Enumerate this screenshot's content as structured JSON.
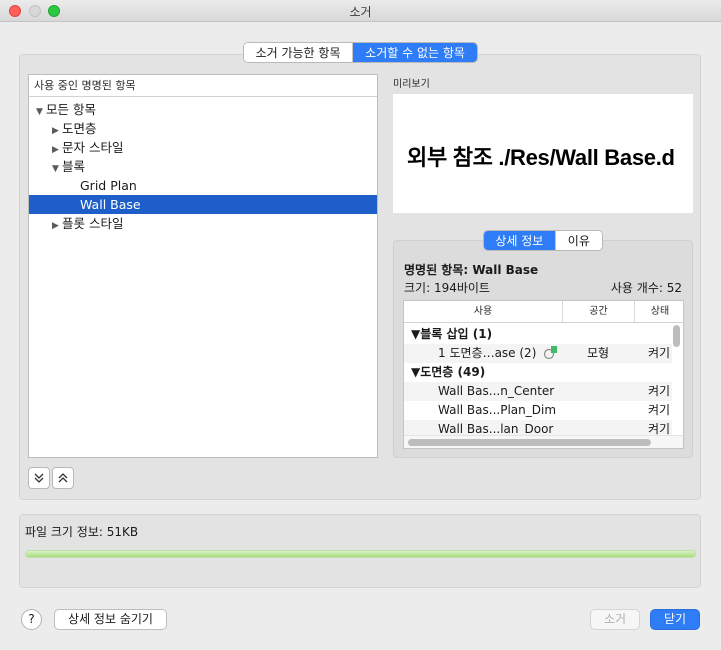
{
  "window": {
    "title": "소거"
  },
  "top_tabs": [
    {
      "label": "소거 가능한 항목",
      "active": false
    },
    {
      "label": "소거할 수 없는 항목",
      "active": true
    }
  ],
  "tree": {
    "header": "사용 중인 명명된 항목",
    "items": [
      {
        "label": "모든 항목",
        "expanded": true,
        "level": 0
      },
      {
        "label": "도면층",
        "expanded": false,
        "level": 1
      },
      {
        "label": "문자 스타일",
        "expanded": false,
        "level": 1
      },
      {
        "label": "블록",
        "expanded": true,
        "level": 1
      },
      {
        "label": "Grid Plan",
        "level": 2
      },
      {
        "label": "Wall Base",
        "level": 2,
        "selected": true
      },
      {
        "label": "플롯 스타일",
        "expanded": false,
        "level": 1
      }
    ]
  },
  "preview": {
    "label": "미리보기",
    "text": "외부 참조 ./Res/Wall Base.d"
  },
  "detail_tabs": [
    {
      "label": "상세 정보",
      "active": true
    },
    {
      "label": "이유",
      "active": false
    }
  ],
  "details": {
    "name_line": "명명된 항목: Wall Base",
    "size_line": "크기: 194바이트",
    "count_line": "사용 개수: 52",
    "columns": [
      "사용",
      "공간",
      "상태"
    ],
    "rows": [
      {
        "type": "group",
        "label": "▼블록 삽입 (1)"
      },
      {
        "type": "item",
        "use": "1 도면층…ase (2)",
        "space": "모형",
        "state": "켜기"
      },
      {
        "type": "group",
        "label": "▼도면층 (49)"
      },
      {
        "type": "item",
        "use": "Wall Bas...n_Center",
        "space": "",
        "state": "켜기"
      },
      {
        "type": "item",
        "use": "Wall Bas...Plan_Dim",
        "space": "",
        "state": "켜기"
      },
      {
        "type": "item",
        "use": "Wall Bas...lan_Door",
        "space": "",
        "state": "켜기"
      }
    ]
  },
  "file_info": {
    "label": "파일 크기 정보: 51KB",
    "progress": 1.0
  },
  "buttons": {
    "help": "?",
    "hide_details": "상세 정보 숨기기",
    "purge": "소거",
    "close": "닫기"
  },
  "colors": {
    "accent": "#2e7cf6",
    "selection": "#1e5ec9",
    "progress": "#a8dd7f"
  }
}
